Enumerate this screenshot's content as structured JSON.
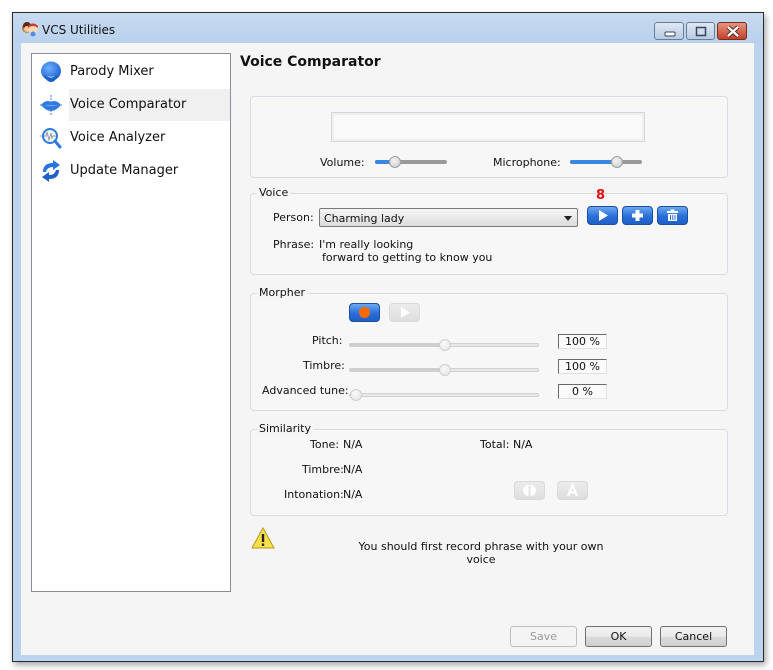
{
  "window": {
    "title": "VCS Utilities",
    "controls": [
      "minimize",
      "maximize",
      "close"
    ]
  },
  "sidebar": {
    "items": [
      {
        "label": "Parody Mixer",
        "icon": "face-icon",
        "selected": false
      },
      {
        "label": "Voice Comparator",
        "icon": "lips-icon",
        "selected": true
      },
      {
        "label": "Voice Analyzer",
        "icon": "magnifier-wave-icon",
        "selected": false
      },
      {
        "label": "Update Manager",
        "icon": "refresh-arrows-icon",
        "selected": false
      }
    ]
  },
  "main": {
    "title": "Voice Comparator",
    "levels": {
      "volume_label": "Volume:",
      "volume_value": 0.3,
      "microphone_label": "Microphone:",
      "microphone_value": 0.65
    },
    "voice": {
      "group_label": "Voice",
      "person_label": "Person:",
      "person_value": "Charming lady",
      "badge": "8",
      "phrase_label": "Phrase:",
      "phrase_line1": "I'm really looking",
      "phrase_line2": "forward to getting to know you",
      "buttons": [
        "play",
        "add",
        "delete"
      ]
    },
    "morpher": {
      "group_label": "Morpher",
      "buttons": [
        "record",
        "play"
      ],
      "pitch_label": "Pitch:",
      "pitch_value": "100 %",
      "pitch_slider": 0.5,
      "timbre_label": "Timbre:",
      "timbre_value": "100 %",
      "timbre_slider": 0.5,
      "advanced_label": "Advanced tune:",
      "advanced_value": "0 %",
      "advanced_slider": 0.0
    },
    "similarity": {
      "group_label": "Similarity",
      "tone_label": "Tone:",
      "tone_value": "N/A",
      "total_label": "Total:",
      "total_value": "N/A",
      "timbre_label": "Timbre:",
      "timbre_value": "N/A",
      "intonation_label": "Intonation:",
      "intonation_value": "N/A",
      "buttons": [
        "compare",
        "auto"
      ]
    },
    "warning": {
      "line1": "You should first record phrase with your own",
      "line2": "voice"
    }
  },
  "footer": {
    "save_label": "Save",
    "ok_label": "OK",
    "cancel_label": "Cancel"
  },
  "colors": {
    "accent_blue": "#2a6fd8",
    "record_orange": "#ff6a00",
    "badge_red": "#e01010"
  }
}
